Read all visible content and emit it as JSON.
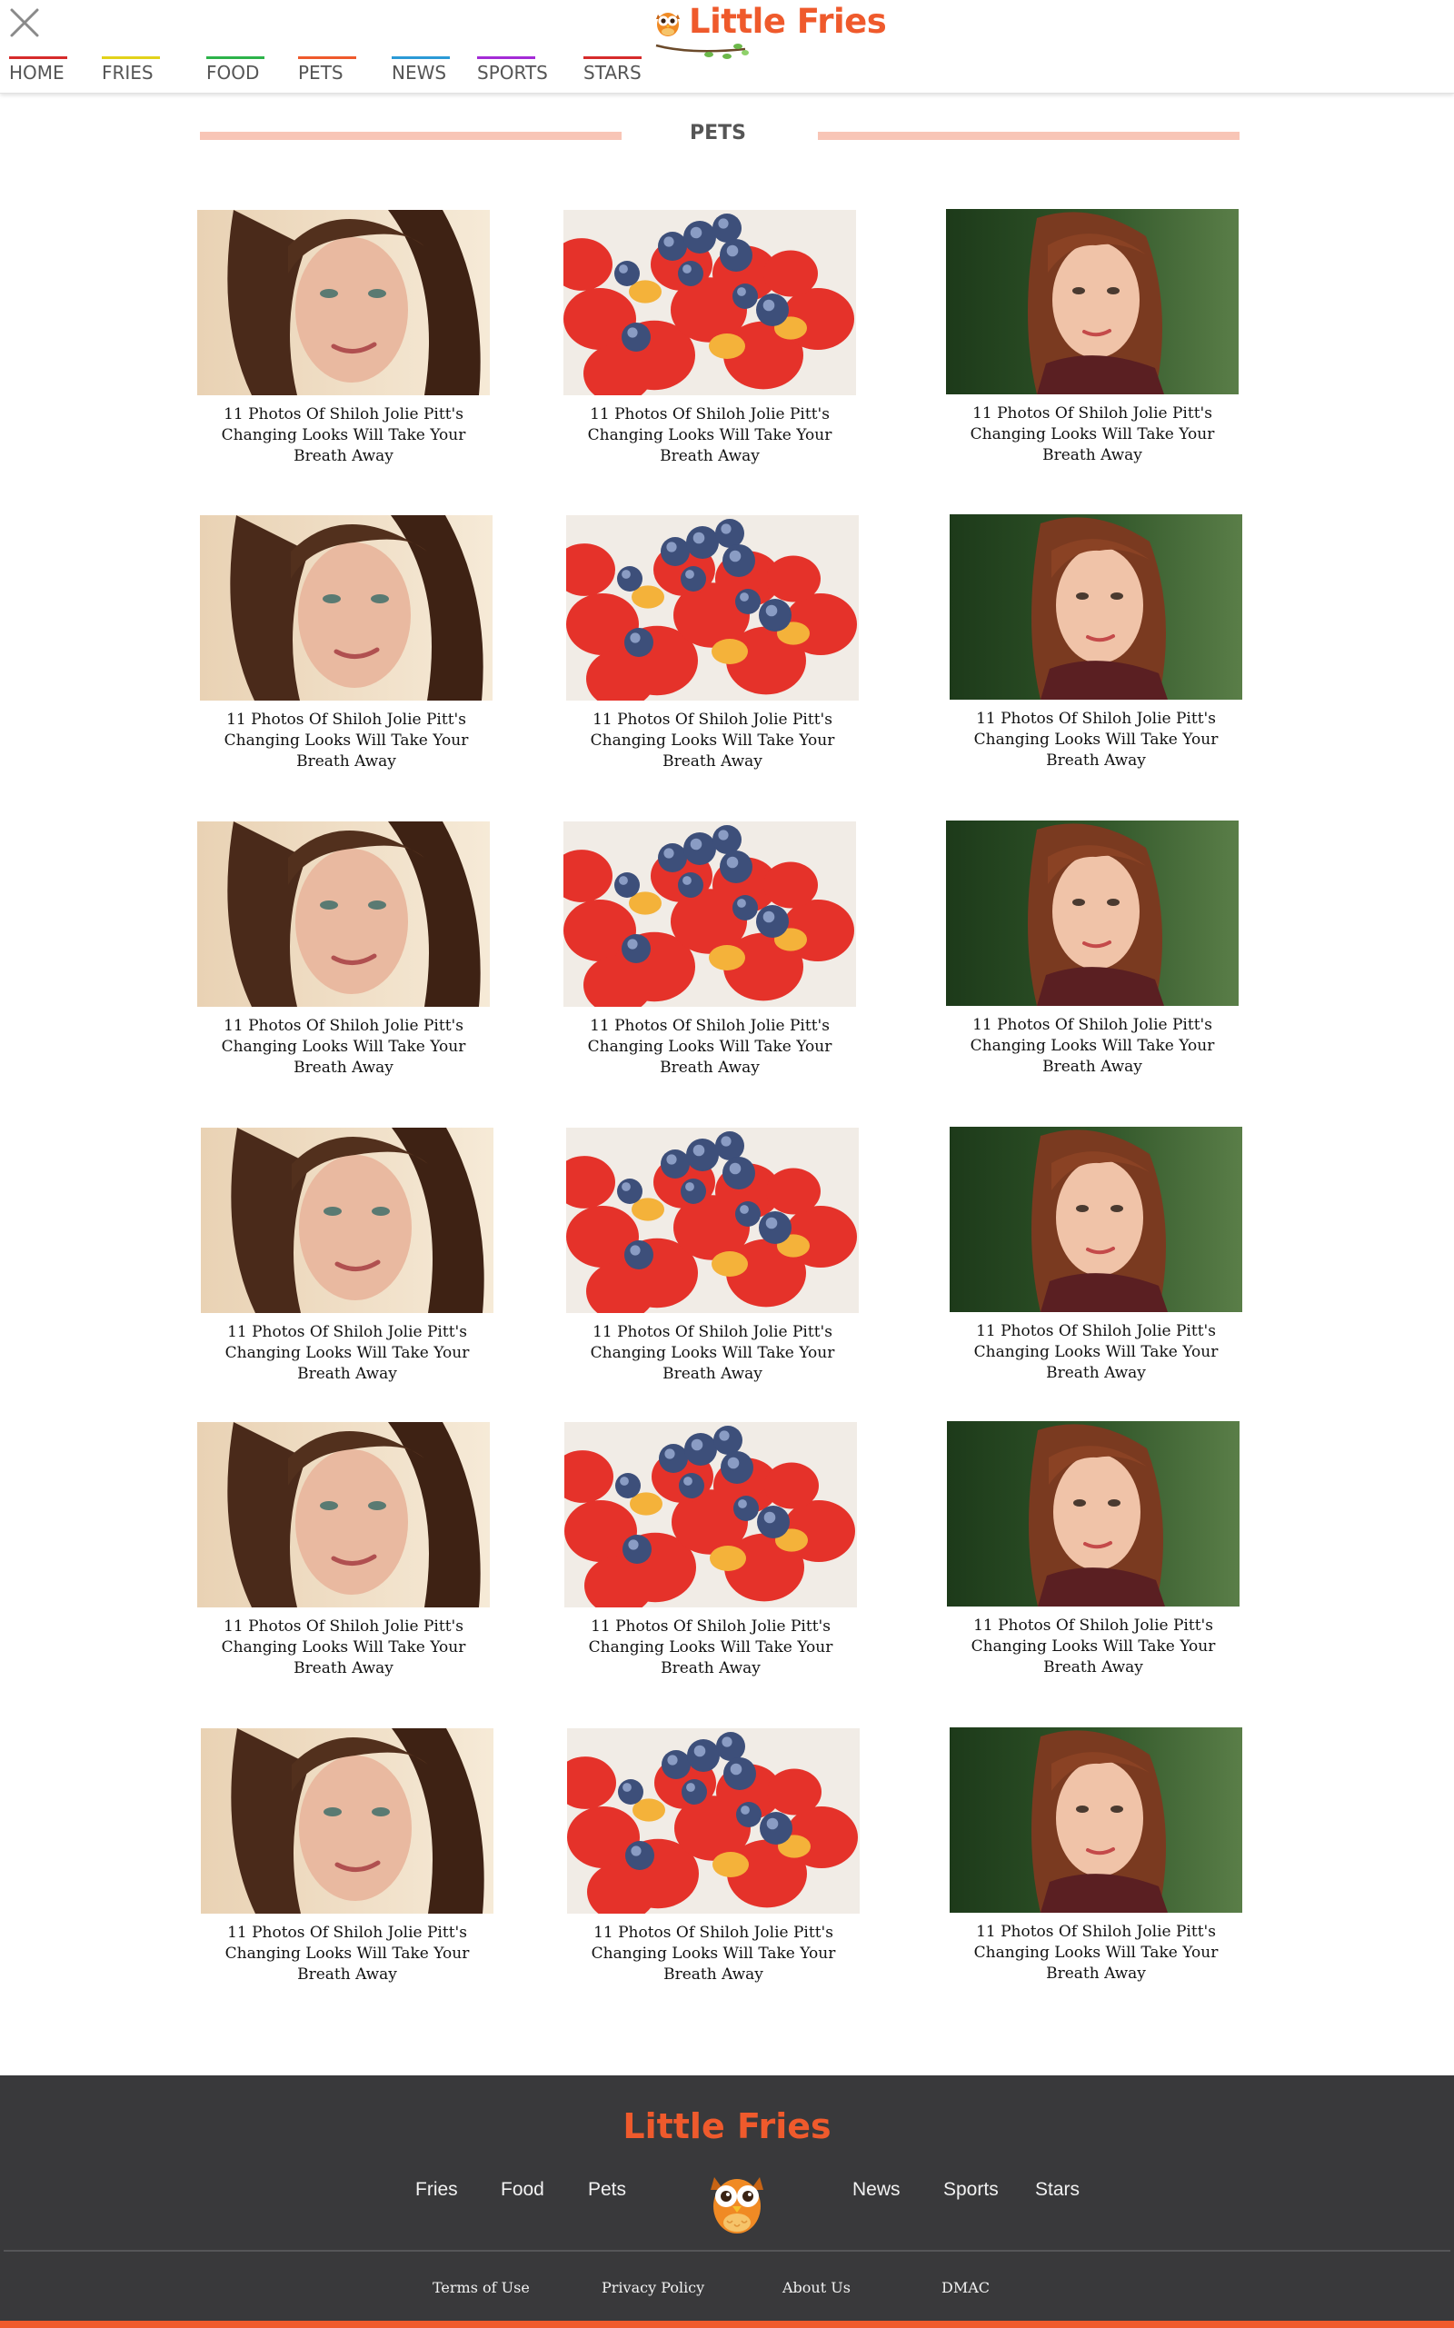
{
  "header": {
    "logo_text": "Little Fries",
    "nav": [
      {
        "label": "HOME",
        "color": "#d62b2b"
      },
      {
        "label": "FRIES",
        "color": "#e2d21a"
      },
      {
        "label": "FOOD",
        "color": "#2db34a"
      },
      {
        "label": "PETS",
        "color": "#ef5a2c"
      },
      {
        "label": "NEWS",
        "color": "#2b9ad6"
      },
      {
        "label": "SPORTS",
        "color": "#a42bd6"
      },
      {
        "label": "STARS",
        "color": "#d62b2b"
      }
    ]
  },
  "section": {
    "title": "PETS"
  },
  "cards": [
    {
      "image": "woman-portrait-dark-hair",
      "caption": "11 Photos Of Shiloh Jolie Pitt's Changing Looks Will Take Your Breath Away"
    },
    {
      "image": "strawberries-blueberries",
      "caption": "11 Photos Of Shiloh Jolie Pitt's Changing Looks Will Take Your Breath Away"
    },
    {
      "image": "woman-portrait-auburn-hair",
      "caption": "11 Photos Of Shiloh Jolie Pitt's Changing Looks Will Take Your Breath Away"
    },
    {
      "image": "woman-portrait-dark-hair",
      "caption": "11 Photos Of Shiloh Jolie Pitt's Changing Looks Will Take Your Breath Away"
    },
    {
      "image": "strawberries-blueberries",
      "caption": "11 Photos Of Shiloh Jolie Pitt's Changing Looks Will Take Your Breath Away"
    },
    {
      "image": "woman-portrait-auburn-hair",
      "caption": "11 Photos Of Shiloh Jolie Pitt's Changing Looks Will Take Your Breath Away"
    },
    {
      "image": "woman-portrait-dark-hair",
      "caption": "11 Photos Of Shiloh Jolie Pitt's Changing Looks Will Take Your Breath Away"
    },
    {
      "image": "strawberries-blueberries",
      "caption": "11 Photos Of Shiloh Jolie Pitt's Changing Looks Will Take Your Breath Away"
    },
    {
      "image": "woman-portrait-auburn-hair",
      "caption": "11 Photos Of Shiloh Jolie Pitt's Changing Looks Will Take Your Breath Away"
    },
    {
      "image": "woman-portrait-dark-hair",
      "caption": "11 Photos Of Shiloh Jolie Pitt's Changing Looks Will Take Your Breath Away"
    },
    {
      "image": "strawberries-blueberries",
      "caption": "11 Photos Of Shiloh Jolie Pitt's Changing Looks Will Take Your Breath Away"
    },
    {
      "image": "woman-portrait-auburn-hair",
      "caption": "11 Photos Of Shiloh Jolie Pitt's Changing Looks Will Take Your Breath Away"
    },
    {
      "image": "woman-portrait-dark-hair",
      "caption": "11 Photos Of Shiloh Jolie Pitt's Changing Looks Will Take Your Breath Away"
    },
    {
      "image": "strawberries-blueberries",
      "caption": "11 Photos Of Shiloh Jolie Pitt's Changing Looks Will Take Your Breath Away"
    },
    {
      "image": "woman-portrait-auburn-hair",
      "caption": "11 Photos Of Shiloh Jolie Pitt's Changing Looks Will Take Your Breath Away"
    },
    {
      "image": "woman-portrait-dark-hair",
      "caption": "11 Photos Of Shiloh Jolie Pitt's Changing Looks Will Take Your Breath Away"
    },
    {
      "image": "strawberries-blueberries",
      "caption": "11 Photos Of Shiloh Jolie Pitt's Changing Looks Will Take Your Breath Away"
    },
    {
      "image": "woman-portrait-auburn-hair",
      "caption": "11 Photos Of Shiloh Jolie Pitt's Changing Looks Will Take Your Breath Away"
    }
  ],
  "footer": {
    "logo_text": "Little Fries",
    "links_left": [
      "Fries",
      "Food",
      "Pets"
    ],
    "links_right": [
      "News",
      "Sports",
      "Stars"
    ],
    "sub_links": [
      "Terms of Use",
      "Privacy Policy",
      "About Us",
      "DMAC"
    ]
  },
  "colors": {
    "brand": "#ef5a2c",
    "section_line": "#f8c5b6",
    "footer_bg": "#39393b"
  }
}
